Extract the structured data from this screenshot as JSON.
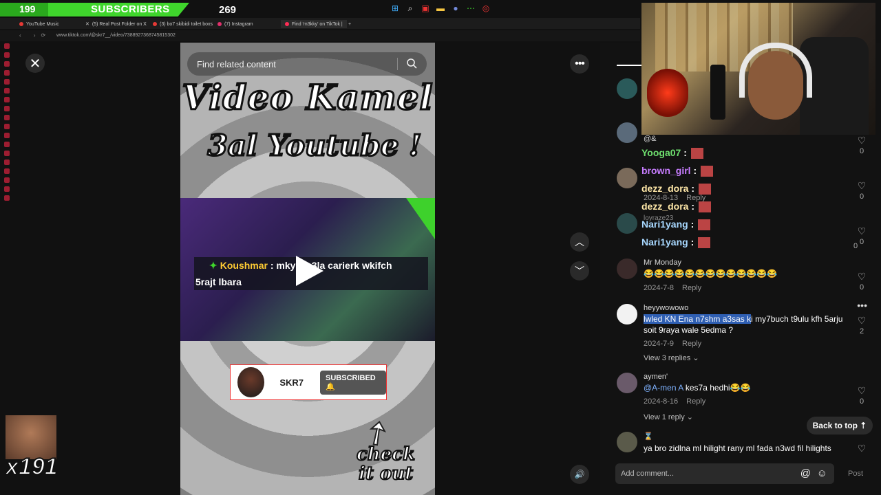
{
  "overlay": {
    "subscriber_count": "199",
    "subscriber_label": "SUBSCRIBERS",
    "subscriber_goal": "269",
    "combo_count": "x191"
  },
  "browser": {
    "tabs": [
      {
        "label": "YouTube Music",
        "color": "#e53935"
      },
      {
        "label": "(5) Real Post Folder on X",
        "color": "#ffffff"
      },
      {
        "label": "(3) bo7 skibidi toilet boxs",
        "color": "#e53935"
      },
      {
        "label": "(7) Instagram",
        "color": "#e1306c"
      },
      {
        "label": "Find 'm3kky' on TikTok |",
        "color": "#ff2d55"
      }
    ],
    "url": "www.tiktok.com/@skr7__/video/7388927368745815302"
  },
  "video": {
    "search_placeholder": "Find related content",
    "title_line1": "Video Kamel",
    "title_line2": "3al Youtube !",
    "chat_user": "Koushmar",
    "chat_line1": ": mky i   a 3la carierk wkifch",
    "chat_line2": "5rajt lbara",
    "channel_name": "SKR7",
    "subscribed_label": "SUBSCRIBED",
    "check_line1": "check",
    "check_line2": "it out"
  },
  "chat_overlay": [
    {
      "user": "Yooga07",
      "color": "#6fe06f"
    },
    {
      "user": "brown_girl",
      "color": "#c77dff"
    },
    {
      "user": "dezz_dora",
      "color": "#ffe8a8"
    },
    {
      "user": "dezz_dora",
      "color": "#ffe8a8"
    },
    {
      "user": "Nari1yang",
      "color": "#a8d8ff"
    },
    {
      "user": "Nari1yang",
      "color": "#a8d8ff"
    }
  ],
  "comments": [
    {
      "user": "Mr Monday",
      "text": "😂😂😂😂😂😂😂😂😂😂😂😂😂",
      "date": "2024-7-8",
      "reply": "Reply",
      "likes": "0"
    },
    {
      "user": "heyywowowo",
      "text_highlight": "lwled KN Ena n7shm a3sas k",
      "text_rest": "i my7buch t9ulu kfh 5arju soit 9raya wale 5edma ?",
      "date": "2024-7-9",
      "reply": "Reply",
      "likes": "2",
      "view_replies": "View 3 replies"
    },
    {
      "user": "aymen'",
      "mention": "@A-men A",
      "text": " kes7a hedhi😂😂",
      "date": "2024-8-16",
      "reply": "Reply",
      "likes": "0",
      "view_replies": "View 1 reply"
    },
    {
      "user": "⌛",
      "text": "ya bro zidlna ml hilight rany ml fada n3wd fil hilights"
    }
  ],
  "partial_comments": {
    "mention_at": "@&",
    "date_1": "2024-8-13",
    "reply_1": "Reply",
    "user_3": "loyraze23",
    "likes": [
      "0",
      "0",
      "0",
      "0"
    ]
  },
  "back_to_top": "Back to top ⇡",
  "add_comment_placeholder": "Add comment...",
  "post_label": "Post"
}
